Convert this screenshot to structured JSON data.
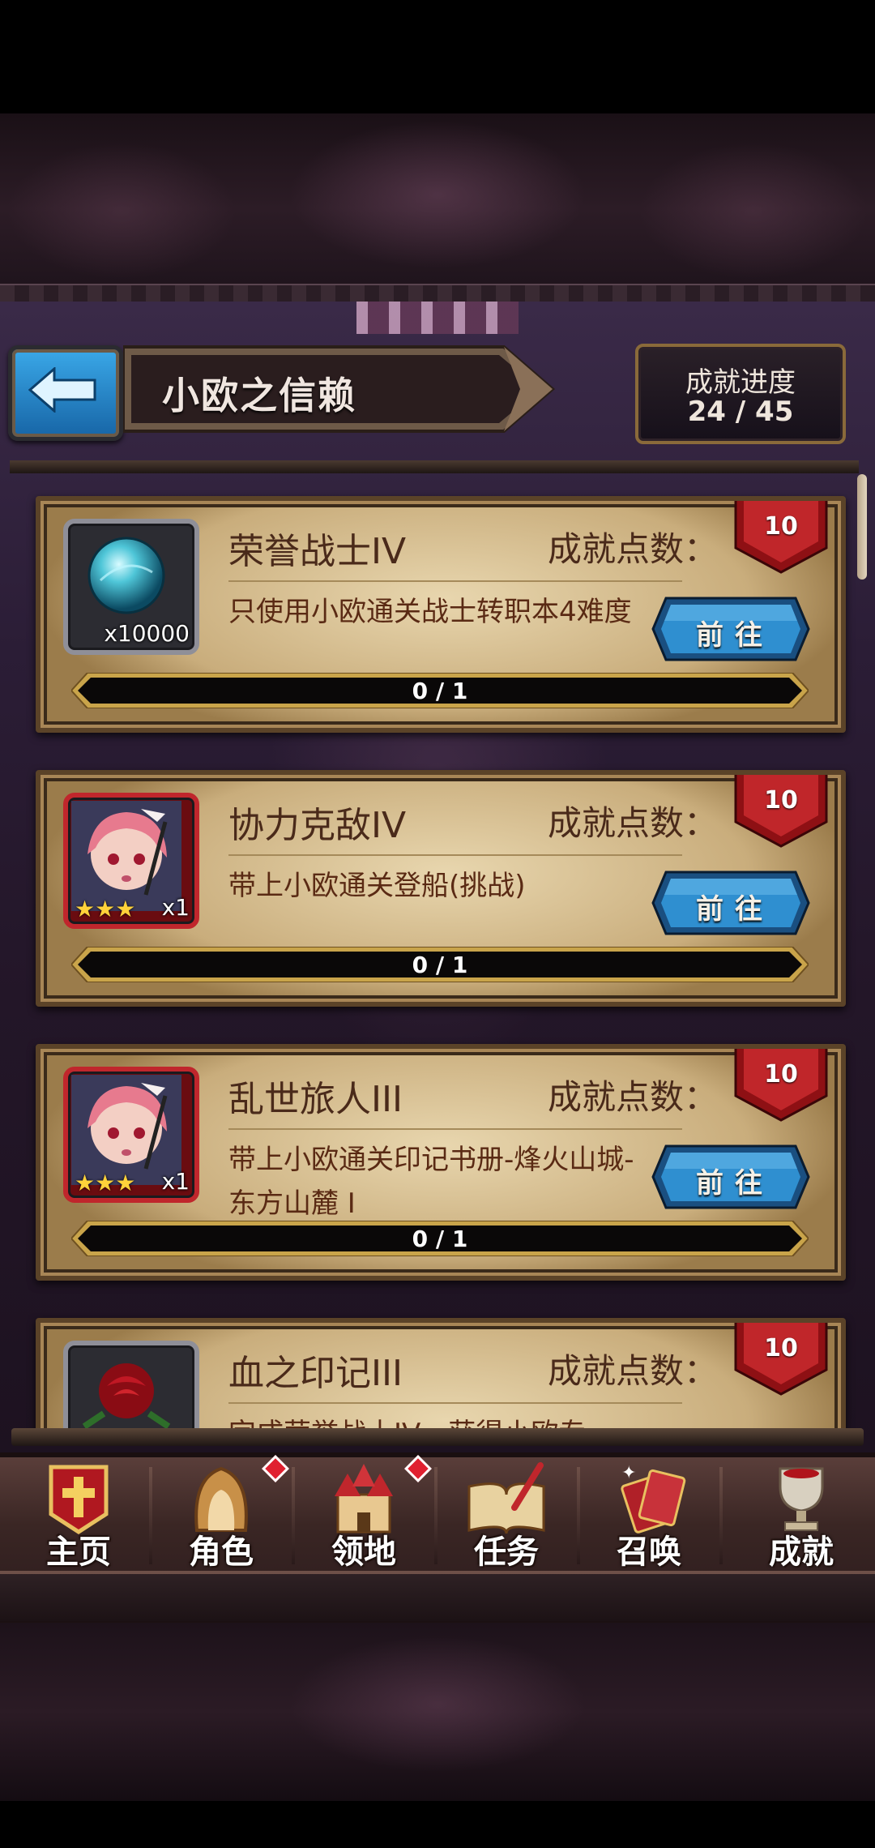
{
  "header": {
    "title": "小欧之信赖",
    "progress_label": "成就进度",
    "progress_value": "24 / 45"
  },
  "colors": {
    "accent_blue": "#1f7fc4",
    "badge_red": "#b0161c",
    "card_parchment": "#d9c195",
    "text_brown": "#4a2a1a"
  },
  "achievements": [
    {
      "name": "荣誉战士IV",
      "points_label": "成就点数：",
      "points": "10",
      "description": "只使用小欧通关战士转职本4难度",
      "icon": "crystal-orb-icon",
      "reward_count": "x10000",
      "go_label": "前往",
      "progress": "0 / 1",
      "progress_fraction": 0
    },
    {
      "name": "协力克敌IV",
      "points_label": "成就点数：",
      "points": "10",
      "description": "带上小欧通关登船(挑战)",
      "icon": "character-portrait-icon",
      "reward_count": "x1",
      "stars": "★★★",
      "go_label": "前往",
      "progress": "0 / 1",
      "progress_fraction": 0
    },
    {
      "name": "乱世旅人III",
      "points_label": "成就点数：",
      "points": "10",
      "description": "带上小欧通关印记书册-烽火山城-东方山麓 I",
      "icon": "character-portrait-icon",
      "reward_count": "x1",
      "stars": "★★★",
      "go_label": "前往",
      "progress": "0 / 1",
      "progress_fraction": 0
    },
    {
      "name": "血之印记III",
      "points_label": "成就点数：",
      "points": "10",
      "description": "完成荣誉战士IV，获得小欧专",
      "icon": "red-rose-icon"
    }
  ],
  "nav": {
    "items": [
      {
        "label": "主页",
        "icon": "home-banner-icon"
      },
      {
        "label": "角色",
        "icon": "character-hood-icon",
        "badge": true
      },
      {
        "label": "领地",
        "icon": "castle-icon",
        "badge": true
      },
      {
        "label": "任务",
        "icon": "quest-book-icon"
      },
      {
        "label": "召唤",
        "icon": "summon-cards-icon"
      },
      {
        "label": "成就",
        "icon": "trophy-icon"
      }
    ]
  }
}
